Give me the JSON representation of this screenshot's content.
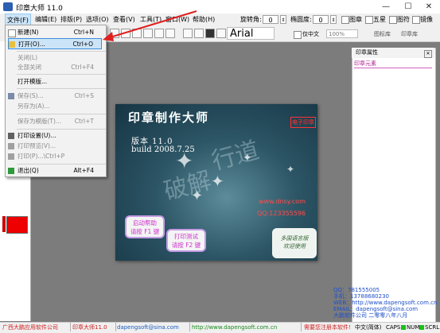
{
  "window": {
    "title": "印章大师 11.0",
    "minimize": "—",
    "maximize": "☐",
    "close": "✕"
  },
  "menubar": [
    {
      "label": "文件(F)"
    },
    {
      "label": "编辑(E)"
    },
    {
      "label": "排版(P)"
    },
    {
      "label": "选项(O)"
    },
    {
      "label": "查看(V)"
    },
    {
      "label": "工具(T)"
    },
    {
      "label": "窗口(W)"
    },
    {
      "label": "帮助(H)"
    }
  ],
  "righttools": {
    "rotate_label": "旋转角:",
    "rotate_value": "0",
    "ellipse_label": "椭圆度:",
    "ellipse_value": "0",
    "checks": [
      "图章",
      "五星",
      "图符",
      "镜像"
    ]
  },
  "toolbar2": {
    "font": "Arial",
    "only_chinese": "仅中文",
    "zoom": "100%",
    "tab1": "图标库",
    "tab2": "印章库"
  },
  "file_menu": {
    "items": [
      {
        "label": "新建(N)",
        "shortcut": "Ctrl+N",
        "enabled": true,
        "icon": "new-doc-icon"
      },
      {
        "label": "打开(O)...",
        "shortcut": "Ctrl+O",
        "enabled": true,
        "icon": "open-folder-icon"
      },
      {
        "label": "关闭(L)",
        "shortcut": "",
        "enabled": false
      },
      {
        "label": "全部关闭",
        "shortcut": "Ctrl+F4",
        "enabled": false
      },
      {
        "label": "打开模版...",
        "shortcut": "",
        "enabled": true
      },
      {
        "label": "保存(S)...",
        "shortcut": "Ctrl+S",
        "enabled": false,
        "icon": "save-icon"
      },
      {
        "label": "另存为(A)...",
        "shortcut": "",
        "enabled": false
      },
      {
        "label": "保存为模版(T)...",
        "shortcut": "Ctrl+T",
        "enabled": false
      },
      {
        "label": "打印设置(U)...",
        "shortcut": "",
        "enabled": true,
        "icon": "print-setup-icon"
      },
      {
        "label": "打印预览(V)...",
        "shortcut": "",
        "enabled": false,
        "icon": "print-preview-icon"
      },
      {
        "label": "打印(P)...\\Ctrl+P",
        "shortcut": "",
        "enabled": false,
        "icon": "print-icon"
      },
      {
        "label": "退出(Q)",
        "shortcut": "Alt+F4",
        "enabled": true,
        "icon": "exit-icon"
      }
    ]
  },
  "splash": {
    "title": "印章制作大师",
    "badge": "电子印章",
    "version": "版本 11.0",
    "build": "build 2008.7.25",
    "url": "www.dnsy.com",
    "qq": "QQ:123355596",
    "btn_help_1": "启动帮助",
    "btn_help_2": "请按 F1 键",
    "btn_test_1": "打印测试",
    "btn_test_2": "请按 F2 键",
    "footer_1": "多国语言版",
    "footer_2": "欢迎使用"
  },
  "properties": {
    "title": "印章属性",
    "element_label": "印章元素"
  },
  "contact": [
    "QQ：781555005",
    "手机：13788680230",
    "WEB：http://www.dapengsoft.com.cn",
    "EMAIL：dapengsoft@sina.com",
    "大鹏软件公司 二零零八年八月"
  ],
  "statusbar": {
    "company": "广西大鹏应用软件公司",
    "product": "印章大师11.0",
    "email": "dapengsoft@sina.com",
    "website": "http://www.dapengsoft.com.cn",
    "register": "需要您注册本软件!",
    "lang": "中文(简体)",
    "caps": "CAPS",
    "num": "NUM",
    "scrl": "SCRL"
  },
  "colors": {
    "accent": "#3c8dd8",
    "swatch": "#ee0000",
    "contact_text": "#1e4fc8"
  }
}
